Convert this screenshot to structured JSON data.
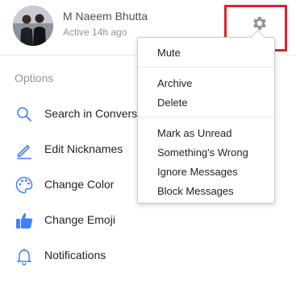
{
  "header": {
    "name": "M Naeem Bhutta",
    "status": "Active 14h ago",
    "avatar_icon": "profile-photo",
    "settings_icon": "gear-icon"
  },
  "options": {
    "title": "Options",
    "items": [
      {
        "label": "Search in Conversa",
        "icon": "search-icon"
      },
      {
        "label": "Edit Nicknames",
        "icon": "pencil-icon"
      },
      {
        "label": "Change Color",
        "icon": "palette-icon"
      },
      {
        "label": "Change Emoji",
        "icon": "thumbs-up-icon"
      },
      {
        "label": "Notifications",
        "icon": "bell-icon"
      }
    ]
  },
  "settings_menu": {
    "groups": [
      [
        "Mute"
      ],
      [
        "Archive",
        "Delete"
      ],
      [
        "Mark as Unread",
        "Something's Wrong",
        "Ignore Messages",
        "Block Messages"
      ]
    ]
  },
  "colors": {
    "accent": "#4080ff",
    "highlight": "#e3202a",
    "muted_text": "#90949c"
  }
}
